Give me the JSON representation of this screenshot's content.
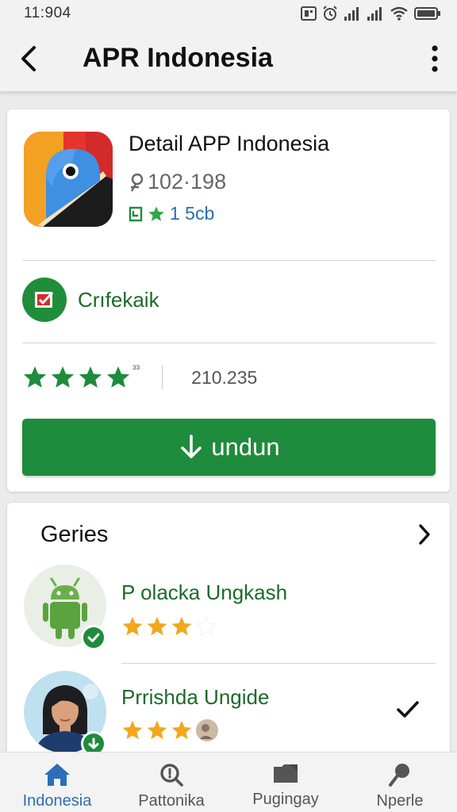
{
  "status_bar": {
    "time": "11:904"
  },
  "app_bar": {
    "title": "APR Indonesia"
  },
  "app_detail": {
    "name": "Detail APP Indonesia",
    "downloads_text": "102·198",
    "size_text": "1 5cb",
    "certificate_label": "Crıfekaik",
    "rating_stars": 4,
    "rating_superscript": "ɜɜ",
    "rating_count": "210.235",
    "download_button_label": "undun",
    "colors": {
      "primary_green": "#1f8b3c",
      "dark_green_text": "#1d6a2a",
      "link_blue": "#2a6fa8"
    }
  },
  "series": {
    "title": "Geries",
    "items": [
      {
        "name": "P olacka Ungkash",
        "stars": 3,
        "avatar_icon": "android-robot-icon",
        "badge_icon": "checkmark-icon"
      },
      {
        "name": "Prrishda Ungide",
        "stars": 3,
        "avatar_icon": "person-photo",
        "badge_icon": "download-arrow-icon",
        "trailing_icon": "checkmark-icon"
      }
    ],
    "star_color": "#f2a81d"
  },
  "bottom_nav": {
    "items": [
      {
        "label": "Indonesia",
        "icon": "home-icon",
        "active": true
      },
      {
        "label": "Pattonika",
        "icon": "search-icon",
        "active": false
      },
      {
        "label": "Pugingay",
        "icon": "folder-icon",
        "active": false
      },
      {
        "label": "Nperle",
        "icon": "pin-icon",
        "active": false
      }
    ],
    "active_color": "#2a6fb8"
  }
}
